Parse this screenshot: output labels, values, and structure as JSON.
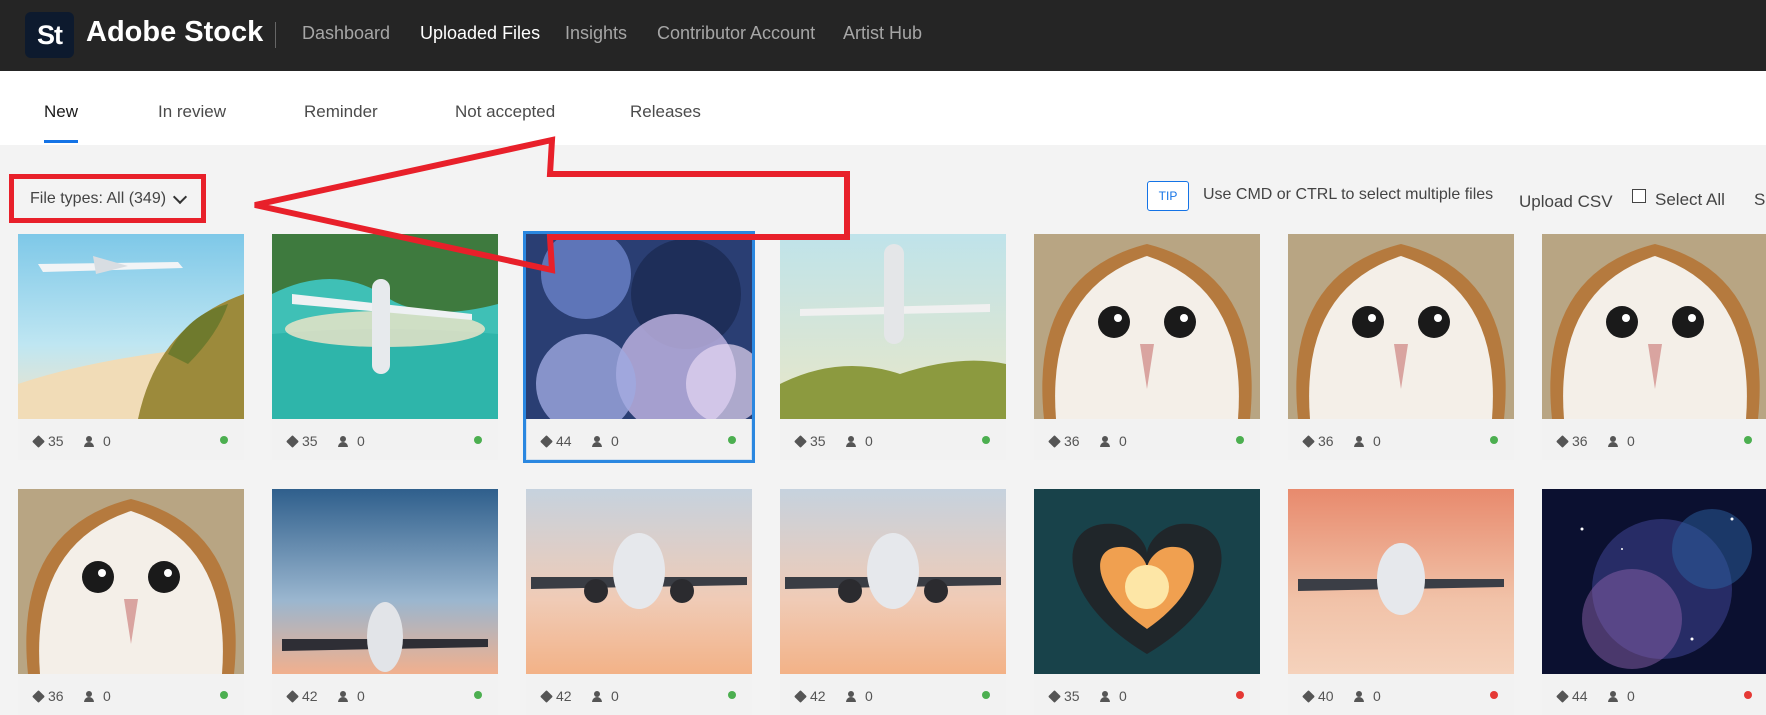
{
  "brand": {
    "logo": "St",
    "name": "Adobe Stock"
  },
  "topnav": [
    {
      "label": "Dashboard",
      "active": false
    },
    {
      "label": "Uploaded Files",
      "active": true
    },
    {
      "label": "Insights",
      "active": false
    },
    {
      "label": "Contributor Account",
      "active": false
    },
    {
      "label": "Artist Hub",
      "active": false
    }
  ],
  "subtabs": [
    {
      "label": "New",
      "active": true
    },
    {
      "label": "In review",
      "active": false
    },
    {
      "label": "Reminder",
      "active": false
    },
    {
      "label": "Not accepted",
      "active": false
    },
    {
      "label": "Releases",
      "active": false
    }
  ],
  "toolbar": {
    "filter_label": "File types: All (349)",
    "tip_badge": "TIP",
    "tip_text": "Use CMD or CTRL to select multiple files",
    "upload_csv": "Upload CSV",
    "select_all": "Select All",
    "cut_text": "S"
  },
  "colors": {
    "accent": "#1473e6",
    "annotation": "#e8202a",
    "status_green": "#4caf50",
    "status_red": "#e53935"
  },
  "files": [
    {
      "subject": "airplane over tropical beach",
      "keywords": "35",
      "releases": "0",
      "status": "green",
      "selected": false
    },
    {
      "subject": "airplane over island lagoon",
      "keywords": "35",
      "releases": "0",
      "status": "green",
      "selected": false
    },
    {
      "subject": "nebula clouds",
      "keywords": "44",
      "releases": "0",
      "status": "green",
      "selected": true
    },
    {
      "subject": "airplane over palm trees",
      "keywords": "35",
      "releases": "0",
      "status": "green",
      "selected": false
    },
    {
      "subject": "barn owl face",
      "keywords": "36",
      "releases": "0",
      "status": "green",
      "selected": false
    },
    {
      "subject": "barn owl face",
      "keywords": "36",
      "releases": "0",
      "status": "green",
      "selected": false
    },
    {
      "subject": "barn owl face",
      "keywords": "36",
      "releases": "0",
      "status": "green",
      "selected": false
    },
    {
      "subject": "barn owl face",
      "keywords": "36",
      "releases": "0",
      "status": "green",
      "selected": false
    },
    {
      "subject": "airplane in sunset sky",
      "keywords": "42",
      "releases": "0",
      "status": "green",
      "selected": false
    },
    {
      "subject": "airplane landing at sunset",
      "keywords": "42",
      "releases": "0",
      "status": "green",
      "selected": false
    },
    {
      "subject": "airplane landing at sunset",
      "keywords": "42",
      "releases": "0",
      "status": "green",
      "selected": false
    },
    {
      "subject": "glowing heart in forest",
      "keywords": "35",
      "releases": "0",
      "status": "red",
      "selected": false
    },
    {
      "subject": "airplane landing at dusk",
      "keywords": "40",
      "releases": "0",
      "status": "red",
      "selected": false
    },
    {
      "subject": "space galaxy",
      "keywords": "44",
      "releases": "0",
      "status": "red",
      "selected": false
    }
  ]
}
